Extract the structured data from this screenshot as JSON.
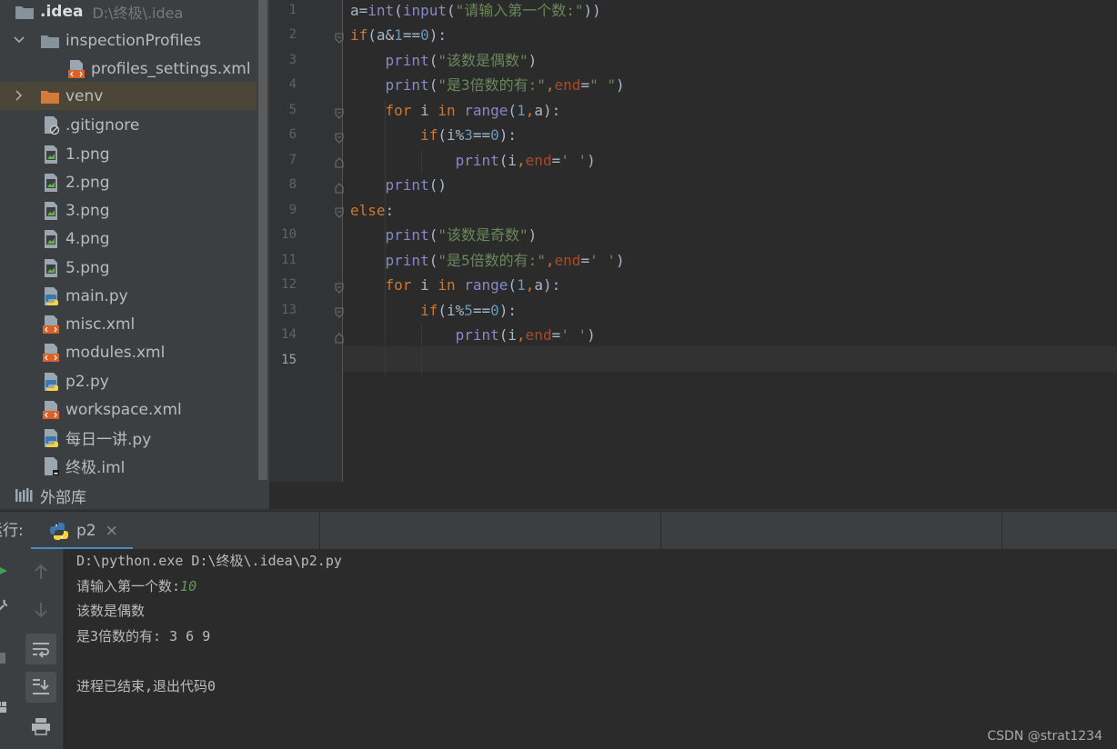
{
  "project_tree": {
    "root_name": ".idea",
    "root_path": "D:\\终极\\.idea",
    "items": [
      {
        "label": "inspectionProfiles",
        "kind": "folder",
        "expanded": true
      },
      {
        "label": "profiles_settings.xml",
        "kind": "xml"
      },
      {
        "label": "venv",
        "kind": "folder-orange",
        "expanded": false
      },
      {
        "label": ".gitignore",
        "kind": "ignore"
      },
      {
        "label": "1.png",
        "kind": "image"
      },
      {
        "label": "2.png",
        "kind": "image"
      },
      {
        "label": "3.png",
        "kind": "image"
      },
      {
        "label": "4.png",
        "kind": "image"
      },
      {
        "label": "5.png",
        "kind": "image"
      },
      {
        "label": "main.py",
        "kind": "python"
      },
      {
        "label": "misc.xml",
        "kind": "xml"
      },
      {
        "label": "modules.xml",
        "kind": "xml"
      },
      {
        "label": "p2.py",
        "kind": "python"
      },
      {
        "label": "workspace.xml",
        "kind": "xml"
      },
      {
        "label": "每日一讲.py",
        "kind": "python"
      },
      {
        "label": "终极.iml",
        "kind": "iml"
      }
    ],
    "external_libraries": "外部库"
  },
  "editor": {
    "line_numbers": [
      "1",
      "2",
      "3",
      "4",
      "5",
      "6",
      "7",
      "8",
      "9",
      "10",
      "11",
      "12",
      "13",
      "14",
      "15"
    ],
    "current_line": "15",
    "lines": [
      "a=int(input(\"请输入第一个数:\"))",
      "if(a&1==0):",
      "    print(\"该数是偶数\")",
      "    print(\"是3倍数的有:\",end=\" \")",
      "    for i in range(1,a):",
      "        if(i%3==0):",
      "            print(i,end=' ')",
      "    print()",
      "else:",
      "    print(\"该数是奇数\")",
      "    print(\"是5倍数的有:\",end=' ')",
      "    for i in range(1,a):",
      "        if(i%5==0):",
      "            print(i,end=' ')",
      ""
    ],
    "colors": {
      "keyword": "#cc7832",
      "string": "#6a8759",
      "number": "#6897bb",
      "builtin": "#8888c6",
      "param": "#aa4926",
      "text": "#a9b7c6"
    }
  },
  "run_panel": {
    "title": "运行:",
    "tab_label": "p2",
    "tab_close": "×",
    "toolbar_icons": [
      "rerun-icon",
      "wrench-icon",
      "stop-icon",
      "layout-icon",
      "up-arrow-icon",
      "down-arrow-icon",
      "soft-wrap-icon",
      "scroll-to-end-icon",
      "print-icon"
    ],
    "console": {
      "command": "D:\\python.exe D:\\终极\\.idea\\p2.py",
      "prompt": "请输入第一个数:",
      "user_input": "10",
      "out1": "该数是偶数",
      "out2": "是3倍数的有: 3 6 9",
      "exit_msg": "进程已结束,退出代码0"
    }
  },
  "watermark": "CSDN @strat1234"
}
